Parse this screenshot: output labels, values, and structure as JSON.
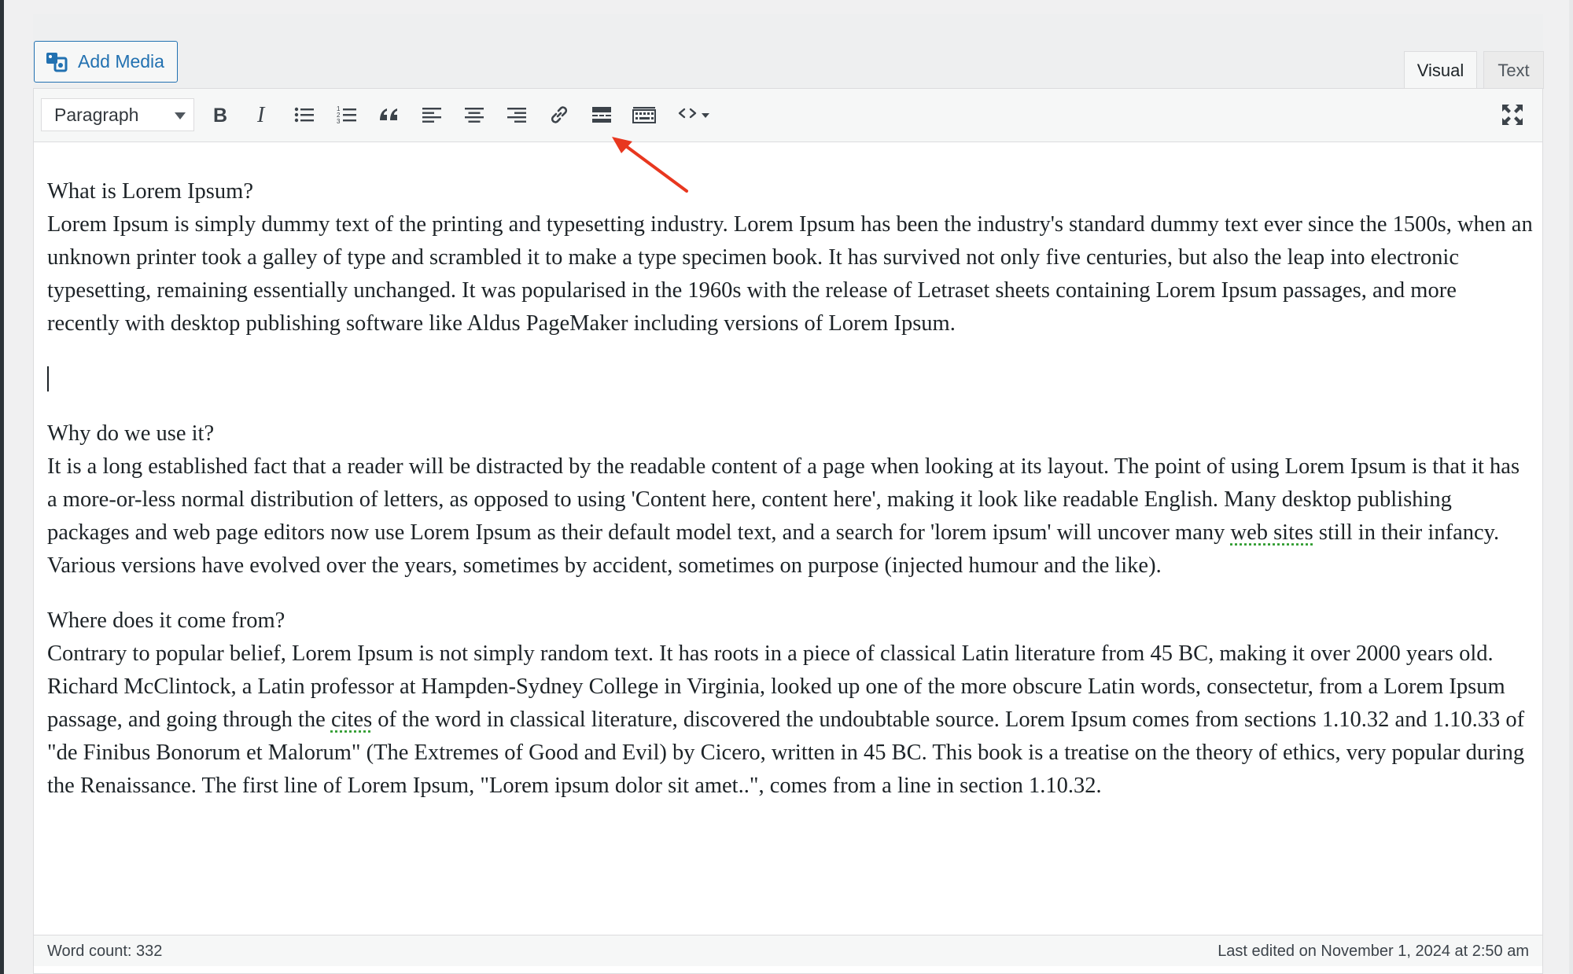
{
  "media": {
    "add_media_label": "Add Media"
  },
  "tabs": {
    "visual": "Visual",
    "text": "Text"
  },
  "toolbar": {
    "format_select_value": "Paragraph",
    "buttons": [
      {
        "icon": "bold-icon"
      },
      {
        "icon": "italic-icon"
      },
      {
        "icon": "bulleted-list-icon"
      },
      {
        "icon": "numbered-list-icon"
      },
      {
        "icon": "blockquote-icon"
      },
      {
        "icon": "align-left-icon"
      },
      {
        "icon": "align-center-icon"
      },
      {
        "icon": "align-right-icon"
      },
      {
        "icon": "link-icon"
      },
      {
        "icon": "read-more-icon"
      },
      {
        "icon": "toolbar-toggle-icon"
      },
      {
        "icon": "code-icon"
      },
      {
        "icon": "fullscreen-icon"
      }
    ]
  },
  "annotation": {
    "color": "#e8371f",
    "target": "read-more-icon"
  },
  "content": {
    "p1_heading": "What is Lorem Ipsum?",
    "p1_body": "Lorem Ipsum is simply dummy text of the printing and typesetting industry. Lorem Ipsum has been the industry's standard dummy text ever since the 1500s, when an unknown printer took a galley of type and scrambled it to make a type specimen book. It has survived not only five centuries, but also the leap into electronic typesetting, remaining essentially unchanged. It was popularised in the 1960s with the release of Letraset sheets containing Lorem Ipsum passages, and more recently with desktop publishing software like Aldus PageMaker including versions of Lorem Ipsum.",
    "p2_heading": "Why do we use it?",
    "p2_body_a": "It is a long established fact that a reader will be distracted by the readable content of a page when looking at its layout. The point of using Lorem Ipsum is that it has a more-or-less normal distribution of letters, as opposed to using 'Content here, content here', making it look like readable English. Many desktop publishing packages and web page editors now use Lorem Ipsum as their default model text, and a search for 'lorem ipsum' will uncover many ",
    "p2_spell": "web sites",
    "p2_body_b": " still in their infancy. Various versions have evolved over the years, sometimes by accident, sometimes on purpose (injected humour and the like).",
    "p3_heading": "Where does it come from?",
    "p3_body_a": "Contrary to popular belief, Lorem Ipsum is not simply random text. It has roots in a piece of classical Latin literature from 45 BC, making it over 2000 years old. Richard McClintock, a Latin professor at Hampden-Sydney College in Virginia, looked up one of the more obscure Latin words, consectetur, from a Lorem Ipsum passage, and going through the ",
    "p3_spell": "cites",
    "p3_body_b": " of the word in classical literature, discovered the undoubtable source. Lorem Ipsum comes from sections 1.10.32 and 1.10.33 of \"de Finibus Bonorum et Malorum\" (The Extremes of Good and Evil) by Cicero, written in 45 BC. This book is a treatise on the theory of ethics, very popular during the Renaissance. The first line of Lorem Ipsum, \"Lorem ipsum dolor sit amet..\", comes from a line in section 1.10.32."
  },
  "status": {
    "word_count": "Word count: 332",
    "last_edited": "Last edited on November 1, 2024 at 2:50 am"
  }
}
